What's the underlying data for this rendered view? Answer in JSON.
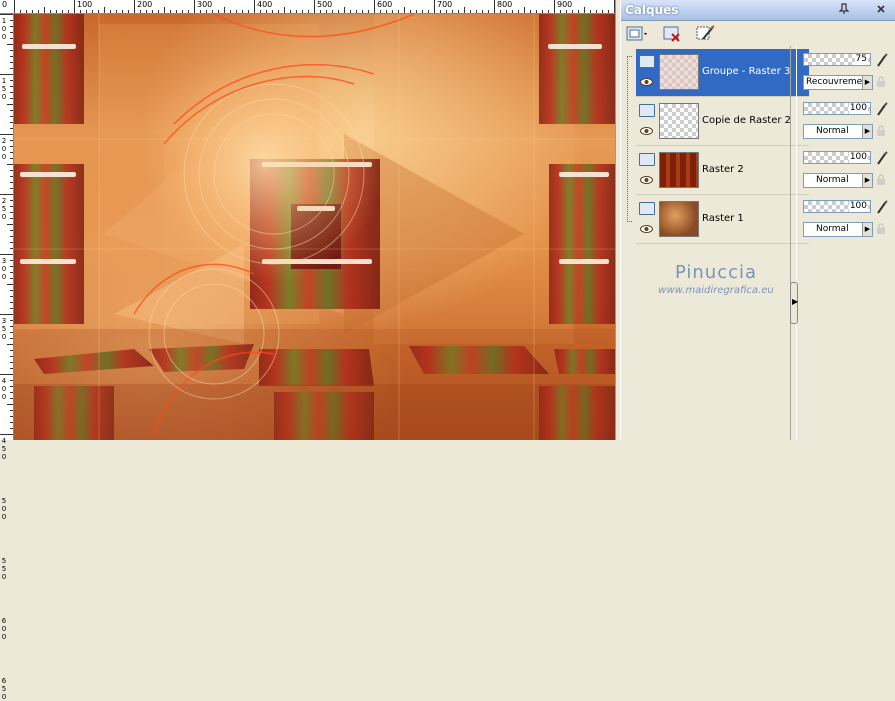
{
  "ruler": {
    "top_labels": [
      "0",
      "100",
      "200",
      "300",
      "400",
      "500",
      "600",
      "700",
      "800",
      "900"
    ],
    "left_labels": [
      "1",
      "0",
      "0",
      "1",
      "5",
      "0",
      "2",
      "0",
      "0",
      "2",
      "5",
      "0",
      "3",
      "0",
      "0",
      "3",
      "5",
      "0",
      "4",
      "0",
      "0",
      "4",
      "5",
      "0",
      "5",
      "0",
      "0",
      "5",
      "5",
      "0",
      "6",
      "0",
      "0",
      "6",
      "5",
      "0"
    ]
  },
  "panel": {
    "title": "Calques",
    "title_buttons": [
      "pin-icon",
      "close-icon"
    ]
  },
  "toolbar": {
    "buttons": [
      "new-layer-icon",
      "delete-layer-icon",
      "layer-properties-icon"
    ]
  },
  "layers": [
    {
      "name": "Groupe - Raster 3",
      "opacity": "75",
      "blend": "Recouvrement",
      "active": true,
      "thumb": "checker-pink"
    },
    {
      "name": "Copie de Raster 2",
      "opacity": "100",
      "blend": "Normal",
      "active": false,
      "thumb": "checker"
    },
    {
      "name": "Raster 2",
      "opacity": "100",
      "blend": "Normal",
      "active": false,
      "thumb": "pattern"
    },
    {
      "name": "Raster 1",
      "opacity": "100",
      "blend": "Normal",
      "active": false,
      "thumb": "image"
    }
  ],
  "watermark": {
    "name": "Pinuccia",
    "url": "www.maidiregrafica.eu"
  },
  "colors": {
    "selection": "#316ac5",
    "panel_bg": "#ece9d8",
    "canvas_orange": "#e08a42",
    "canvas_dark_red": "#7a1e12"
  }
}
